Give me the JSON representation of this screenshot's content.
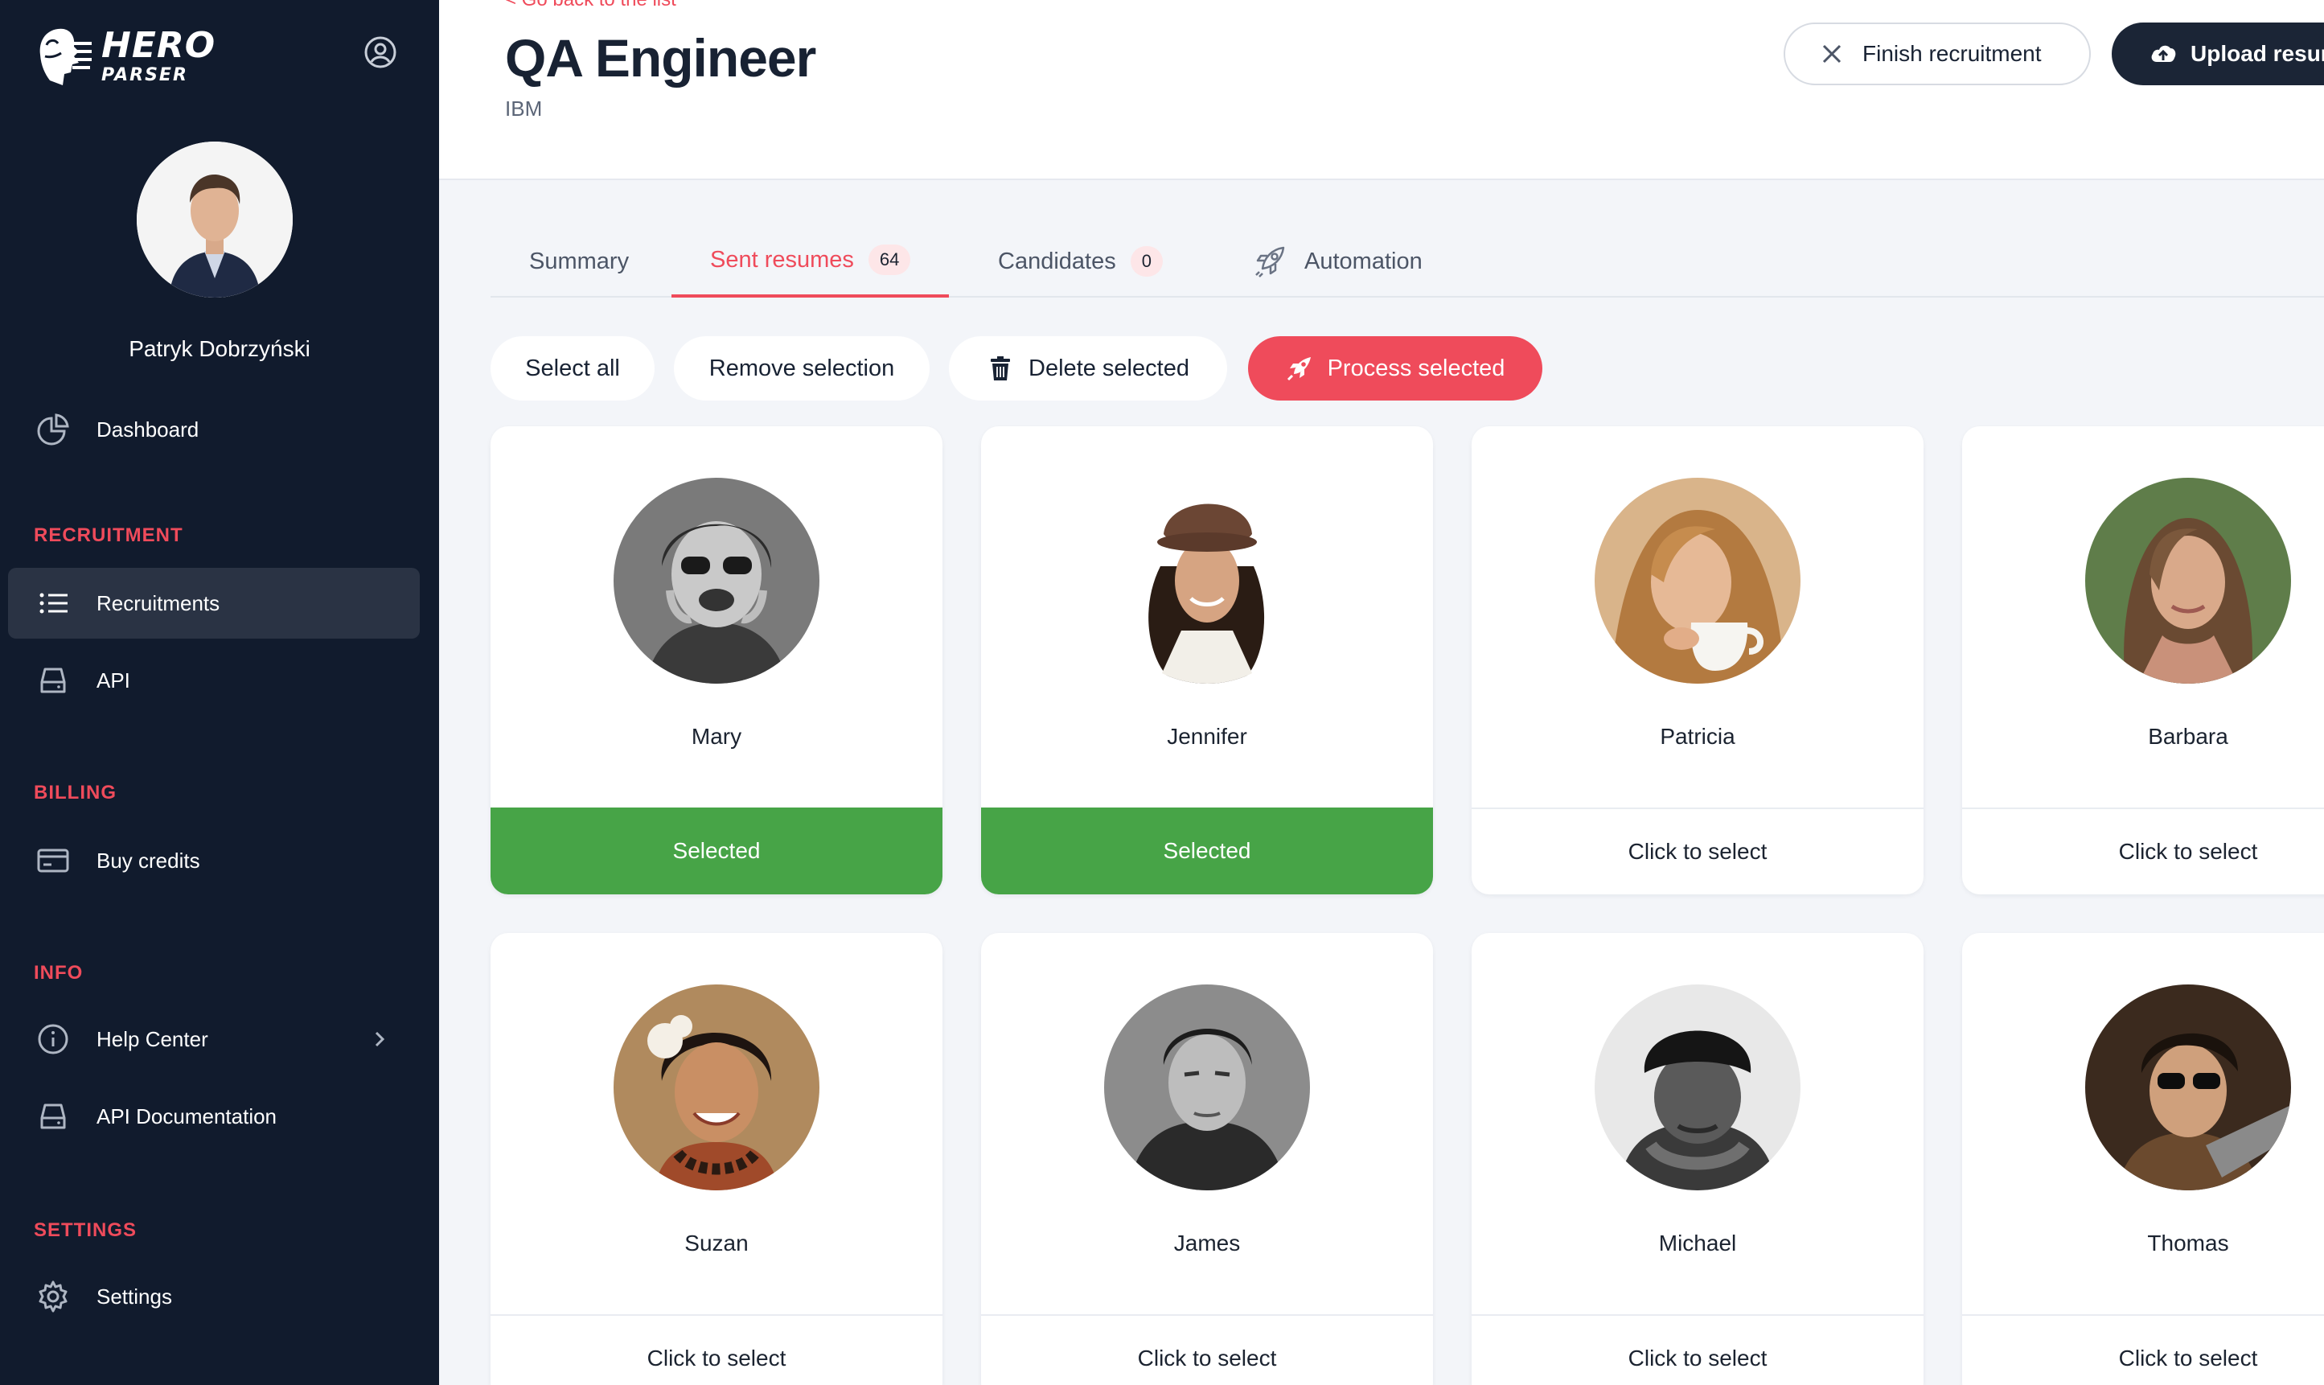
{
  "brand": {
    "name": "HERO",
    "sub": "PARSER"
  },
  "user": {
    "name": "Patryk Dobrzyński"
  },
  "sidebar": {
    "dashboard": "Dashboard",
    "sections": {
      "recruitment": "RECRUITMENT",
      "billing": "BILLING",
      "info": "INFO",
      "settings": "SETTINGS"
    },
    "items": {
      "recruitments": "Recruitments",
      "api": "API",
      "buy_credits": "Buy credits",
      "help_center": "Help Center",
      "api_docs": "API Documentation",
      "settings": "Settings"
    }
  },
  "header": {
    "back_link": "< Go back to the list",
    "title": "QA Engineer",
    "company": "IBM",
    "finish_button": "Finish recruitment",
    "upload_button": "Upload resumes"
  },
  "tabs": [
    {
      "label": "Summary"
    },
    {
      "label": "Sent resumes",
      "count": "64"
    },
    {
      "label": "Candidates",
      "count": "0"
    },
    {
      "label": "Automation"
    }
  ],
  "actions": {
    "select_all": "Select all",
    "remove_selection": "Remove selection",
    "delete_selected": "Delete selected",
    "process_selected": "Process selected"
  },
  "candidates": [
    {
      "name": "Mary",
      "status": "Selected"
    },
    {
      "name": "Jennifer",
      "status": "Selected"
    },
    {
      "name": "Patricia",
      "status": "Click to select"
    },
    {
      "name": "Barbara",
      "status": "Click to select"
    },
    {
      "name": "Suzan",
      "status": "Click to select"
    },
    {
      "name": "James",
      "status": "Click to select"
    },
    {
      "name": "Michael",
      "status": "Click to select"
    },
    {
      "name": "Thomas",
      "status": "Click to select"
    }
  ],
  "colors": {
    "sidebar": "#111b2d",
    "accent": "#ef4b5b",
    "selected": "#47a447"
  }
}
